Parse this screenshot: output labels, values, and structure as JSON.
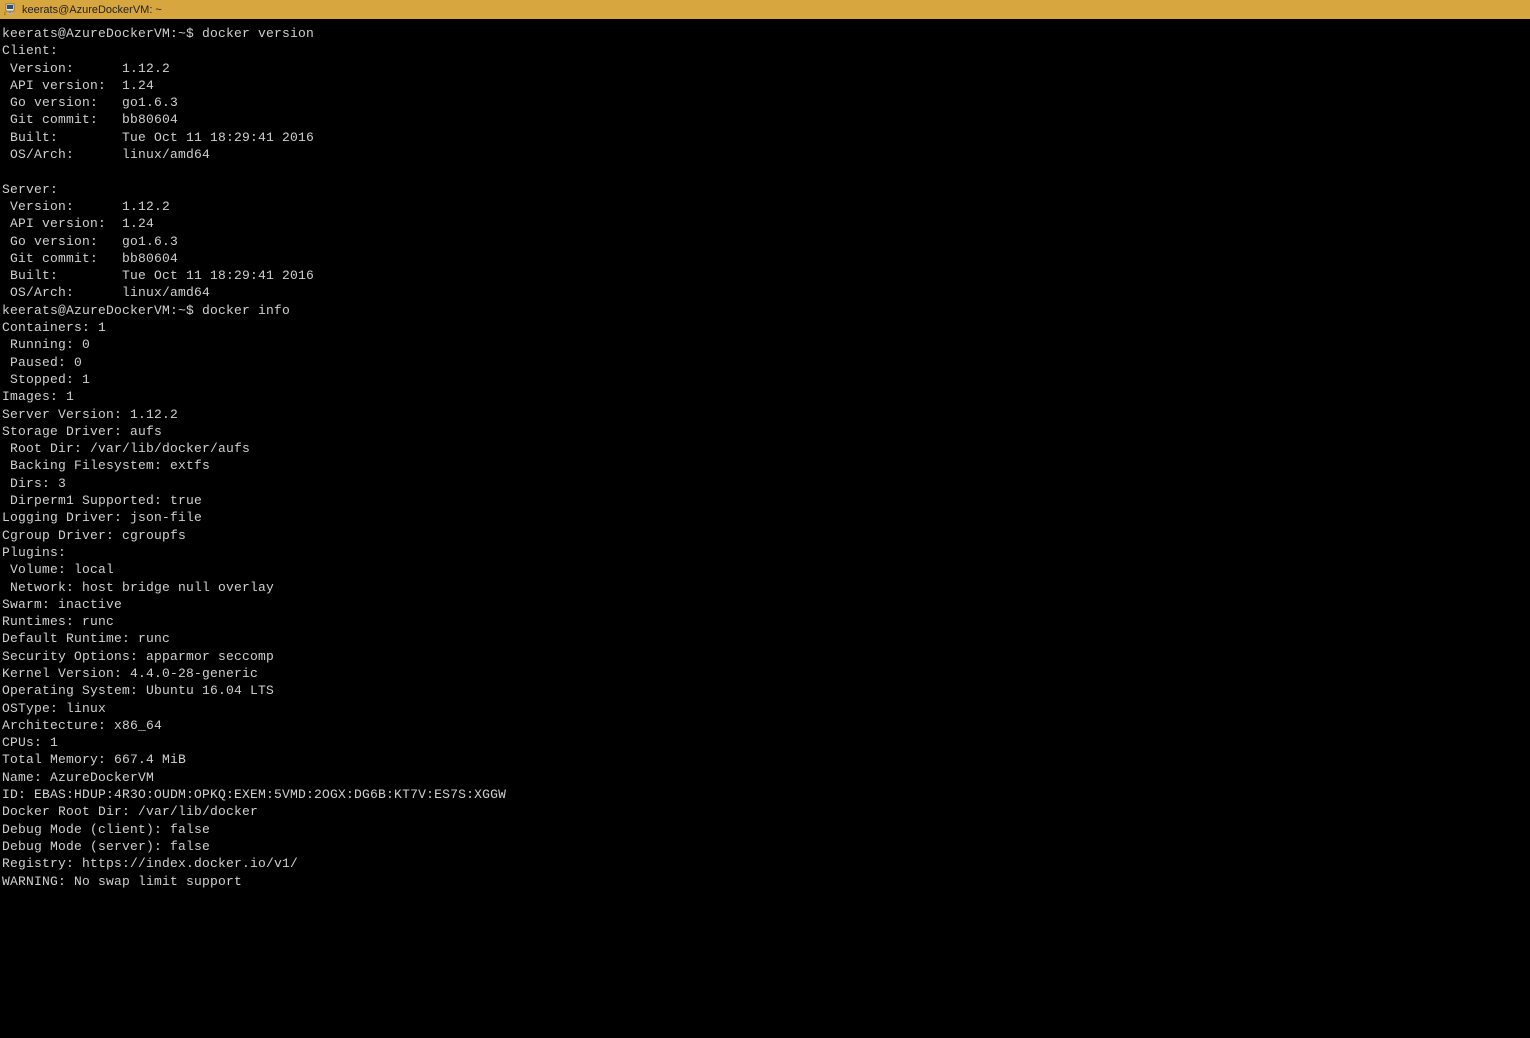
{
  "titlebar": {
    "text": "keerats@AzureDockerVM: ~"
  },
  "terminal": {
    "lines": [
      "keerats@AzureDockerVM:~$ docker version",
      "Client:",
      " Version:      1.12.2",
      " API version:  1.24",
      " Go version:   go1.6.3",
      " Git commit:   bb80604",
      " Built:        Tue Oct 11 18:29:41 2016",
      " OS/Arch:      linux/amd64",
      "",
      "Server:",
      " Version:      1.12.2",
      " API version:  1.24",
      " Go version:   go1.6.3",
      " Git commit:   bb80604",
      " Built:        Tue Oct 11 18:29:41 2016",
      " OS/Arch:      linux/amd64",
      "keerats@AzureDockerVM:~$ docker info",
      "Containers: 1",
      " Running: 0",
      " Paused: 0",
      " Stopped: 1",
      "Images: 1",
      "Server Version: 1.12.2",
      "Storage Driver: aufs",
      " Root Dir: /var/lib/docker/aufs",
      " Backing Filesystem: extfs",
      " Dirs: 3",
      " Dirperm1 Supported: true",
      "Logging Driver: json-file",
      "Cgroup Driver: cgroupfs",
      "Plugins:",
      " Volume: local",
      " Network: host bridge null overlay",
      "Swarm: inactive",
      "Runtimes: runc",
      "Default Runtime: runc",
      "Security Options: apparmor seccomp",
      "Kernel Version: 4.4.0-28-generic",
      "Operating System: Ubuntu 16.04 LTS",
      "OSType: linux",
      "Architecture: x86_64",
      "CPUs: 1",
      "Total Memory: 667.4 MiB",
      "Name: AzureDockerVM",
      "ID: EBAS:HDUP:4R3O:OUDM:OPKQ:EXEM:5VMD:2OGX:DG6B:KT7V:ES7S:XGGW",
      "Docker Root Dir: /var/lib/docker",
      "Debug Mode (client): false",
      "Debug Mode (server): false",
      "Registry: https://index.docker.io/v1/",
      "WARNING: No swap limit support"
    ]
  }
}
